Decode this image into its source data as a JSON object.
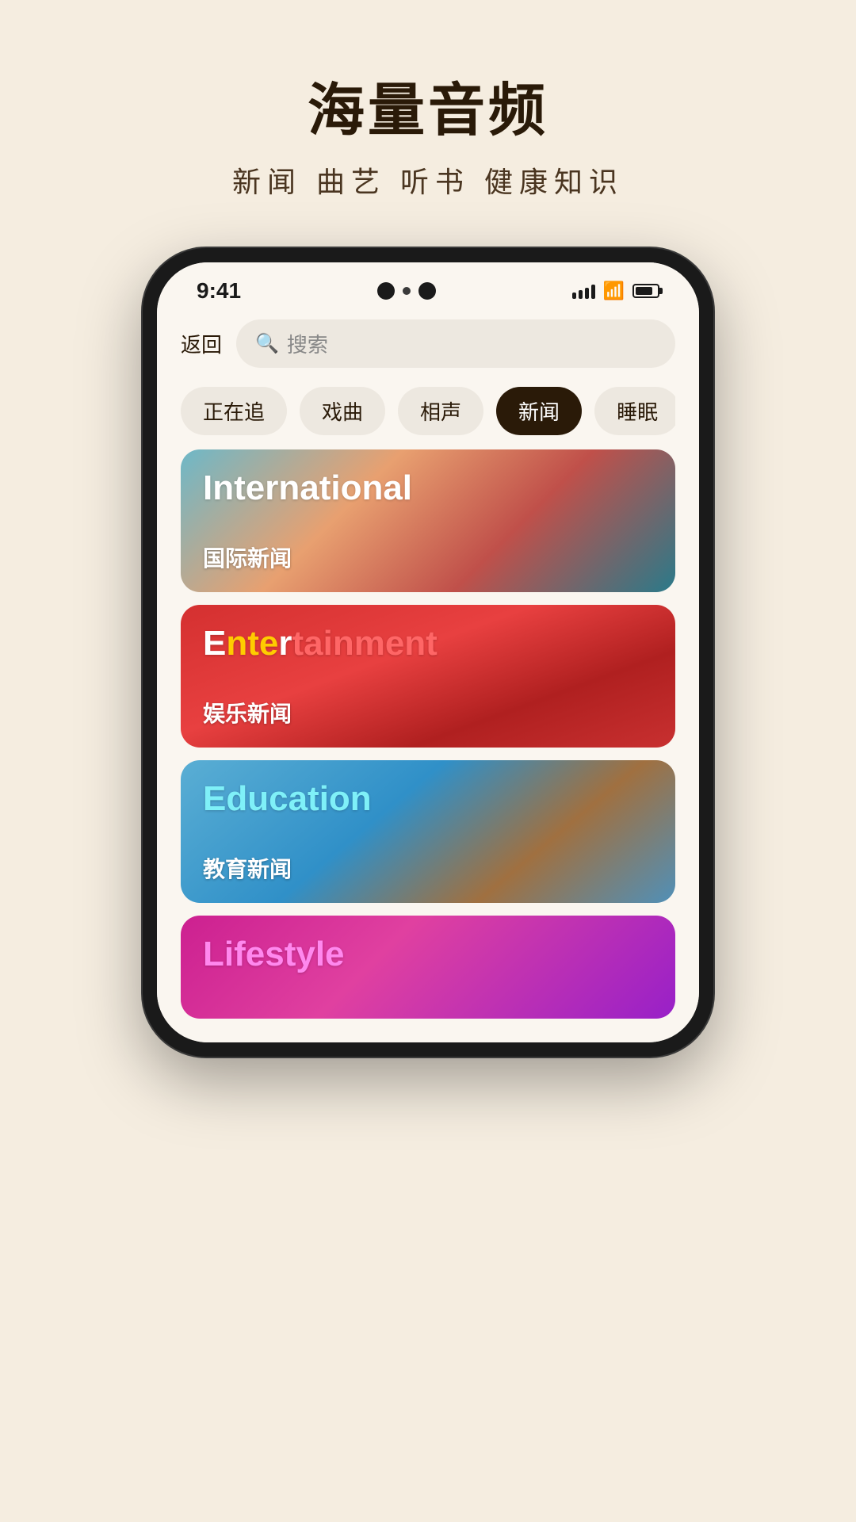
{
  "page": {
    "title": "海量音频",
    "subtitle": "新闻 曲艺 听书 健康知识"
  },
  "status_bar": {
    "time": "9:41",
    "signal_label": "signal",
    "wifi_label": "wifi",
    "battery_label": "battery"
  },
  "nav": {
    "back_label": "返回",
    "search_placeholder": "搜索"
  },
  "categories": [
    {
      "id": "following",
      "label": "正在追",
      "active": false
    },
    {
      "id": "drama",
      "label": "戏曲",
      "active": false
    },
    {
      "id": "crosstalk",
      "label": "相声",
      "active": false
    },
    {
      "id": "news",
      "label": "新闻",
      "active": true
    },
    {
      "id": "sleep",
      "label": "睡眠",
      "active": false
    }
  ],
  "cards": [
    {
      "id": "international",
      "en_title": "International",
      "zh_title": "国际新闻",
      "bg_class": "bg-international"
    },
    {
      "id": "entertainment",
      "en_title": "Entertainment",
      "zh_title": "娱乐新闻",
      "bg_class": "bg-entertainment"
    },
    {
      "id": "education",
      "en_title": "Education",
      "zh_title": "教育新闻",
      "bg_class": "bg-education"
    },
    {
      "id": "lifestyle",
      "en_title": "Lifestyle",
      "zh_title": "",
      "bg_class": "bg-lifestyle"
    }
  ]
}
